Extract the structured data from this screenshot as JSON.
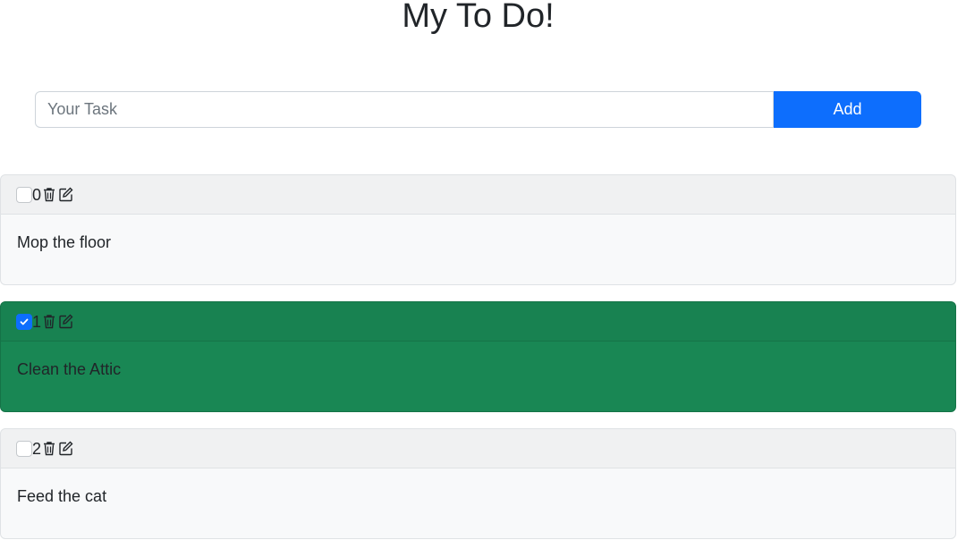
{
  "header": {
    "title": "My To Do!"
  },
  "form": {
    "placeholder": "Your Task",
    "value": "",
    "add_label": "Add"
  },
  "tasks": [
    {
      "index": "0",
      "text": "Mop the floor",
      "done": false
    },
    {
      "index": "1",
      "text": "Clean the Attic",
      "done": true
    },
    {
      "index": "2",
      "text": "Feed the cat",
      "done": false
    }
  ],
  "icons": {
    "delete": "trash-icon",
    "edit": "edit-icon",
    "checked": "check-icon"
  },
  "colors": {
    "primary": "#0d6efd",
    "success": "#198754",
    "card_bg": "#f8f9fa"
  }
}
